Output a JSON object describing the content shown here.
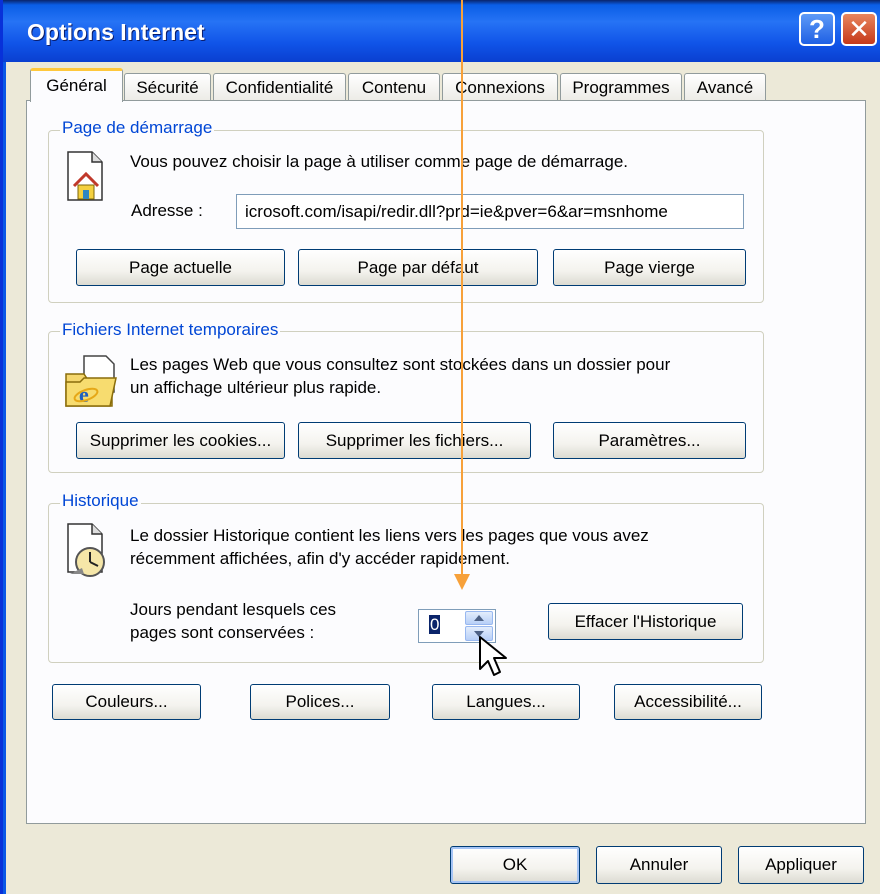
{
  "window": {
    "title": "Options Internet",
    "help_glyph": "?",
    "close_glyph": "✕"
  },
  "tabs": [
    {
      "label": "Général",
      "active": true
    },
    {
      "label": "Sécurité"
    },
    {
      "label": "Confidentialité"
    },
    {
      "label": "Contenu"
    },
    {
      "label": "Connexions"
    },
    {
      "label": "Programmes"
    },
    {
      "label": "Avancé"
    }
  ],
  "home": {
    "legend": "Page de démarrage",
    "description": "Vous pouvez choisir la page à utiliser comme page de démarrage.",
    "address_label": "Adresse :",
    "address_value": "icrosoft.com/isapi/redir.dll?prd=ie&pver=6&ar=msnhome",
    "buttons": {
      "current": "Page actuelle",
      "default": "Page par défaut",
      "blank": "Page vierge"
    }
  },
  "temp_files": {
    "legend": "Fichiers Internet temporaires",
    "description_line1": "Les pages Web que vous consultez sont stockées dans un dossier pour",
    "description_line2": "un affichage ultérieur plus rapide.",
    "buttons": {
      "cookies": "Supprimer les cookies...",
      "files": "Supprimer les fichiers...",
      "settings": "Paramètres..."
    }
  },
  "history": {
    "legend": "Historique",
    "description_line1": "Le dossier Historique contient les liens vers les pages que vous avez",
    "description_line2": "récemment affichées, afin d'y accéder rapidement.",
    "days_label_line1": "Jours pendant lesquels ces",
    "days_label_line2": "pages sont conservées :",
    "days_value": "0",
    "clear_button": "Effacer l'Historique"
  },
  "bottom_buttons": {
    "colors": "Couleurs...",
    "fonts": "Polices...",
    "languages": "Langues...",
    "accessibility": "Accessibilité..."
  },
  "dialog_buttons": {
    "ok": "OK",
    "cancel": "Annuler",
    "apply": "Appliquer"
  },
  "colors": {
    "title_bar": "#0a58e6",
    "dialog_bg": "#ece9d8",
    "legend_text": "#0046d5",
    "annotation_arrow": "#f7a13a",
    "tab_active_top": "#ffc83c"
  },
  "icons": [
    "help-icon",
    "close-icon",
    "home-page-icon",
    "temp-files-folder-icon",
    "history-clock-icon",
    "spin-up-icon",
    "spin-down-icon",
    "mouse-cursor-icon",
    "annotation-arrow"
  ]
}
